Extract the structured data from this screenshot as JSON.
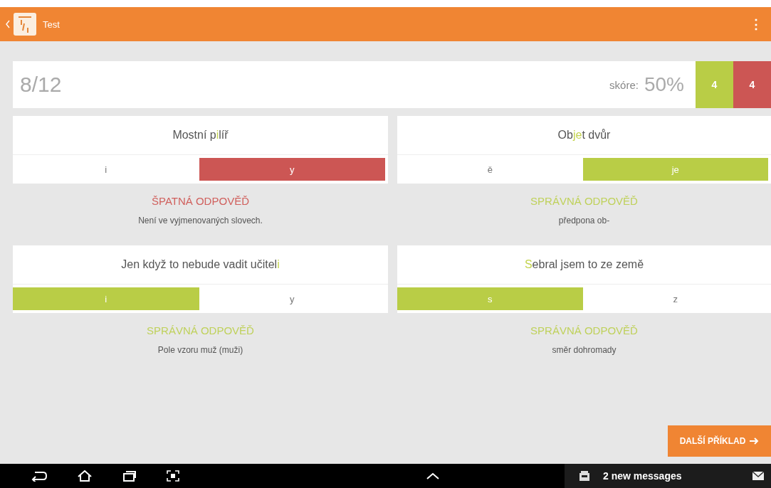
{
  "app_bar": {
    "title": "Test",
    "menu_glyph": "⋮"
  },
  "score_bar": {
    "progress": "8/12",
    "score_label": "skóre:",
    "score_value": "50%",
    "counters": [
      {
        "value": "4",
        "kind": "correct"
      },
      {
        "value": "4",
        "kind": "wrong"
      }
    ]
  },
  "exercises": [
    {
      "parts": [
        {
          "text": "Mostní p",
          "highlight": false
        },
        {
          "text": "i",
          "highlight": true
        },
        {
          "text": "líř",
          "highlight": false
        }
      ],
      "options": [
        {
          "label": "i",
          "selected": false
        },
        {
          "label": "y",
          "selected": true
        }
      ],
      "correct": false,
      "result": "ŠPATNÁ ODPOVĚĎ",
      "explanation": "Není ve vyjmenovaných slovech."
    },
    {
      "parts": [
        {
          "text": "Ob",
          "highlight": false
        },
        {
          "text": "je",
          "highlight": true
        },
        {
          "text": "t dvůr",
          "highlight": false
        }
      ],
      "options": [
        {
          "label": "ě",
          "selected": false
        },
        {
          "label": "je",
          "selected": true
        }
      ],
      "correct": true,
      "result": "SPRÁVNÁ ODPOVĚĎ",
      "explanation": "předpona ob-"
    },
    {
      "parts": [
        {
          "text": "Jen když to nebude vadit učitel",
          "highlight": false
        },
        {
          "text": "i",
          "highlight": true
        }
      ],
      "options": [
        {
          "label": "i",
          "selected": true
        },
        {
          "label": "y",
          "selected": false
        }
      ],
      "correct": true,
      "result": "SPRÁVNÁ ODPOVĚĎ",
      "explanation": "Pole vzoru muž (muži)"
    },
    {
      "parts": [
        {
          "text": "S",
          "highlight": true
        },
        {
          "text": "ebral jsem to ze země",
          "highlight": false
        }
      ],
      "options": [
        {
          "label": "s",
          "selected": true
        },
        {
          "label": "z",
          "selected": false
        }
      ],
      "correct": true,
      "result": "SPRÁVNÁ ODPOVĚĎ",
      "explanation": "směr dohromady"
    }
  ],
  "next_button": {
    "label": "DALŠÍ PŘÍKLAD"
  },
  "nav_bar": {
    "notification": {
      "title": "2 new messages"
    }
  }
}
